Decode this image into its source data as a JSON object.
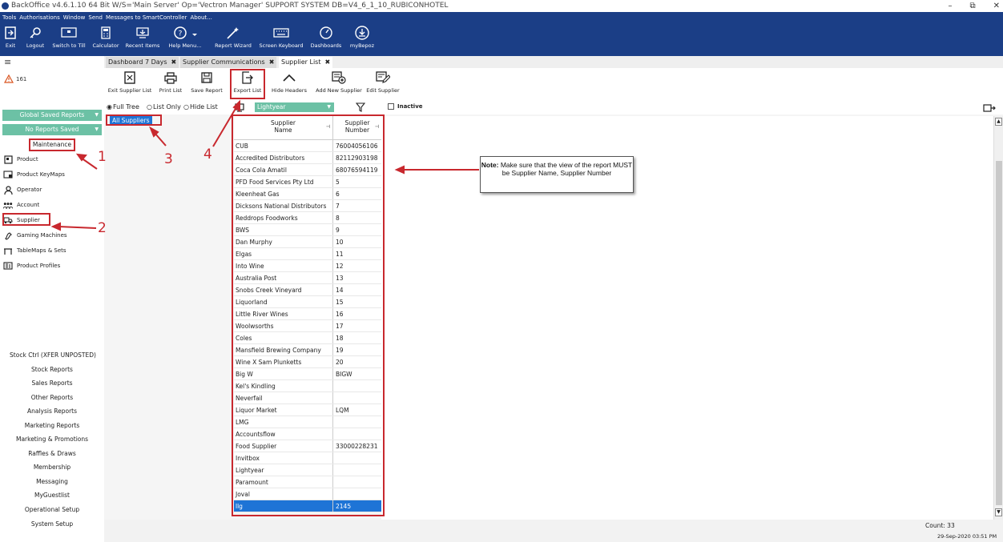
{
  "window": {
    "title": "BackOffice v4.6.1.10 64 Bit W/S='Main Server'  Op='Vectron Manager'  SUPPORT SYSTEM DB=V4_6_1_10_RUBICONHOTEL",
    "min": "–",
    "max": "⧉",
    "close": "✕"
  },
  "menu": [
    "Tools",
    "Authorisations",
    "Window",
    "Send",
    "Messages to SmartController",
    "About..."
  ],
  "toolbar": {
    "exit": "Exit",
    "logout": "Logout",
    "switch_to_till": "Switch to Till",
    "calculator": "Calculator",
    "recent_items": "Recent Items",
    "help_menu": "Help Menu...",
    "report_wizard": "Report Wizard",
    "screen_keyboard": "Screen Keyboard",
    "dashboards": "Dashboards",
    "mybepoz": "myBepoz"
  },
  "left": {
    "alert_count": "161",
    "global_saved_reports": "Global Saved Reports",
    "no_reports_saved": "No Reports Saved",
    "maintenance": "Maintenance",
    "nav": [
      "Product",
      "Product KeyMaps",
      "Operator",
      "Account",
      "Supplier",
      "Gaming Machines",
      "TableMaps & Sets",
      "Product Profiles"
    ],
    "reports": [
      "Stock Ctrl (XFER UNPOSTED)",
      "Stock Reports",
      "Sales Reports",
      "Other Reports",
      "Analysis Reports",
      "Marketing Reports",
      "Marketing & Promotions",
      "Raffles & Draws",
      "Membership",
      "Messaging",
      "MyGuestlist",
      "Operational Setup",
      "System Setup"
    ]
  },
  "tabs": {
    "dashboard": "Dashboard 7 Days",
    "supplier_comm": "Supplier Communications",
    "supplier_list": "Supplier List",
    "close": "✖"
  },
  "ribbon": {
    "exit_supplier_list": "Exit Supplier List",
    "print_list": "Print List",
    "save_report": "Save Report",
    "export_list": "Export List",
    "hide_headers": "Hide Headers",
    "add_new_supplier": "Add New Supplier",
    "edit_supplier": "Edit Supplier"
  },
  "options": {
    "full_tree": "Full Tree",
    "list_only": "List Only",
    "hide_list": "Hide List",
    "filter_value": "Lightyear",
    "inactive": "Inactive"
  },
  "tree": {
    "all_suppliers": "All Suppliers"
  },
  "table": {
    "header_name": "Supplier Name",
    "header_number": "Supplier Number",
    "rows": [
      [
        "CUB",
        "76004056106"
      ],
      [
        "Accredited Distributors",
        "82112903198"
      ],
      [
        "Coca Cola Amatil",
        "68076594119"
      ],
      [
        "PFD Food Services Pty Ltd",
        "5"
      ],
      [
        "Kleenheat Gas",
        "6"
      ],
      [
        "Dicksons National Distributors",
        "7"
      ],
      [
        "Reddrops Foodworks",
        "8"
      ],
      [
        "BWS",
        "9"
      ],
      [
        "Dan Murphy",
        "10"
      ],
      [
        "Elgas",
        "11"
      ],
      [
        "Into Wine",
        "12"
      ],
      [
        "Australia Post",
        "13"
      ],
      [
        "Snobs Creek Vineyard",
        "14"
      ],
      [
        "Liquorland",
        "15"
      ],
      [
        "Little River Wines",
        "16"
      ],
      [
        "Woolwsorths",
        "17"
      ],
      [
        "Coles",
        "18"
      ],
      [
        "Mansfield Brewing Company",
        "19"
      ],
      [
        "Wine X Sam Plunketts",
        "20"
      ],
      [
        "Big W",
        "BIGW"
      ],
      [
        "Kel's Kindling",
        ""
      ],
      [
        "Neverfail",
        ""
      ],
      [
        "Liquor Market",
        "LQM"
      ],
      [
        "LMG",
        ""
      ],
      [
        "Accountsflow",
        ""
      ],
      [
        "Food Supplier",
        "33000228231"
      ],
      [
        "Invitbox",
        ""
      ],
      [
        "Lightyear",
        ""
      ],
      [
        "Paramount",
        ""
      ],
      [
        "Joval",
        ""
      ],
      [
        "llg",
        "2145"
      ]
    ]
  },
  "annotations": {
    "n1": "1",
    "n2": "2",
    "n3": "3",
    "n4": "4",
    "note_bold": "Note:",
    "note_text": "Make sure that the view of the report MUST be Supplier Name, Supplier Number"
  },
  "status": {
    "count": "Count: 33",
    "datetime": "29-Sep-2020  03:51 PM"
  },
  "colors": {
    "navy": "#1b3e86",
    "green": "#6cc1a5",
    "red": "#c8282e",
    "selection": "#1e74d6"
  }
}
